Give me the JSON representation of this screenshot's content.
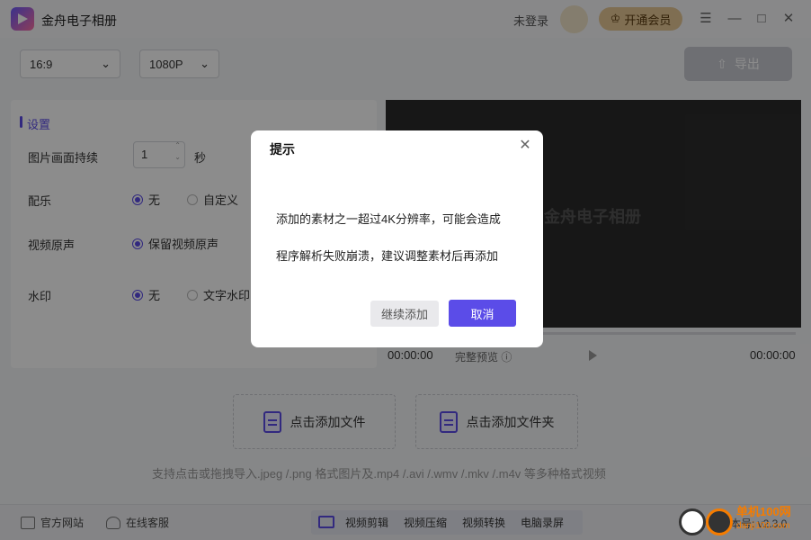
{
  "titlebar": {
    "app_title": "金舟电子相册",
    "login_text": "未登录",
    "vip_label": "开通会员",
    "vip_icon": "crown-icon",
    "window_controls": [
      "menu-icon",
      "minimize-icon",
      "maximize-icon",
      "close-icon"
    ]
  },
  "toolbar": {
    "ratio_value": "16:9",
    "resolution_value": "1080P",
    "export_label": "导出"
  },
  "settings": {
    "title": "设置",
    "duration_label": "图片画面持续",
    "duration_value": "1",
    "duration_unit": "秒",
    "music_label": "配乐",
    "music_opt_none": "无",
    "music_opt_custom": "自定义",
    "music_selected": "无",
    "audio_label": "视频原声",
    "audio_opt_keep": "保留视频原声",
    "audio_selected": "保留视频原声",
    "watermark_label": "水印",
    "watermark_opt_none": "无",
    "watermark_opt_text": "文字水印",
    "watermark_selected": "无"
  },
  "preview": {
    "watermark_text": "金舟电子相册",
    "time_current": "00:00:00",
    "full_preview_label": "完整预览 ⓘ",
    "time_total": "00:00:00",
    "progress": 0
  },
  "dropzone": {
    "add_file": "点击添加文件",
    "add_folder": "点击添加文件夹",
    "hint": "支持点击或拖拽导入.jpeg /.png 格式图片及.mp4 /.avi /.wmv /.mkv /.m4v 等多种格式视频"
  },
  "footer": {
    "website": "官方网站",
    "support": "在线客服",
    "tools": [
      "视频剪辑",
      "视频压缩",
      "视频转换",
      "电脑录屏"
    ],
    "version": "本号: v2.3.0"
  },
  "badge": {
    "site_name": "单机100网",
    "site_url": "danji100.com"
  },
  "dialog": {
    "title": "提示",
    "message_line1": "添加的素材之一超过4K分辨率，可能会造成",
    "message_line2": "程序解析失败崩溃，建议调整素材后再添加",
    "continue_label": "继续添加",
    "cancel_label": "取消"
  },
  "colors": {
    "accent": "#5b4ce8",
    "vip": "#e7c996",
    "overlay": "rgba(0,0,0,0.45)"
  }
}
